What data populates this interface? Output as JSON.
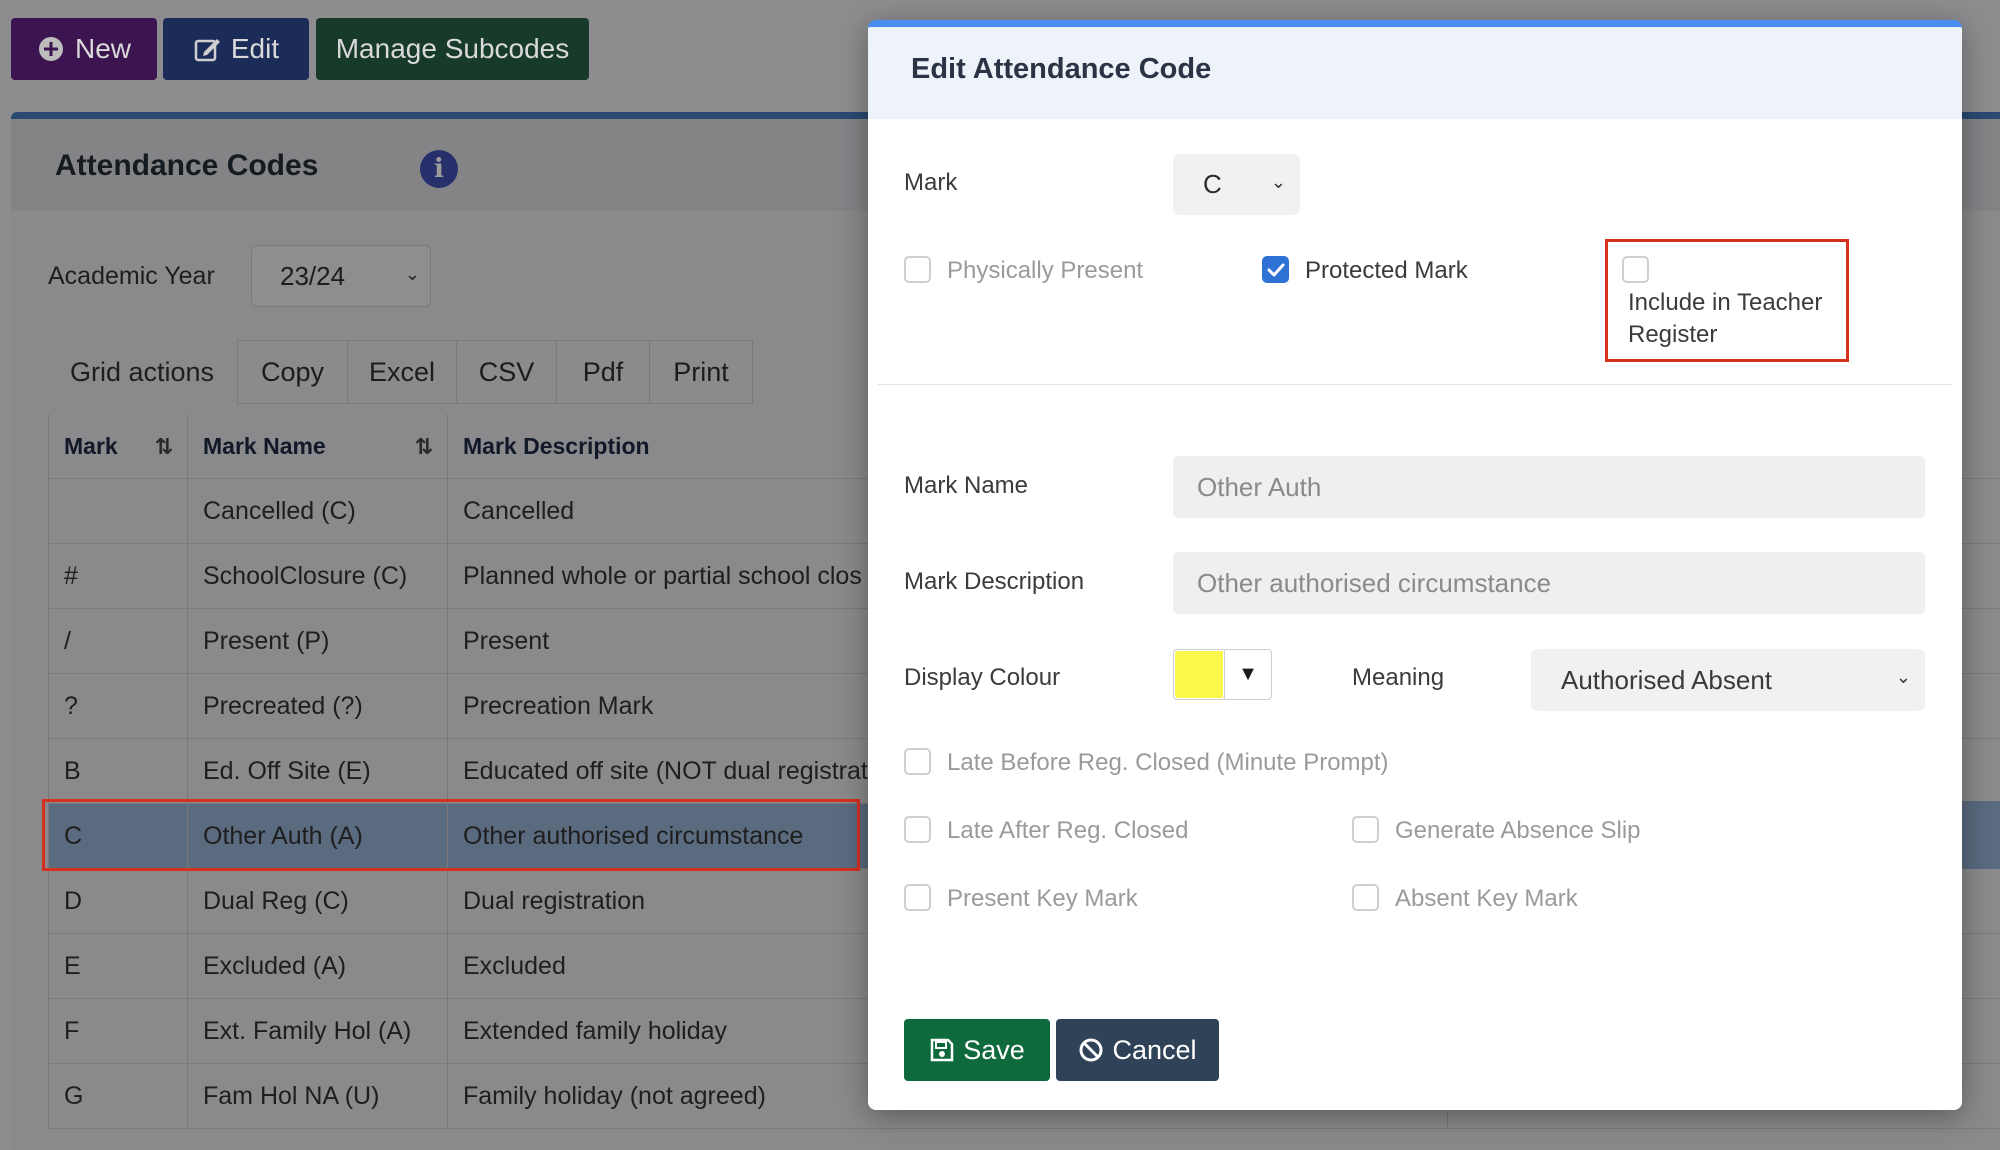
{
  "toolbar": {
    "new_label": "New",
    "edit_label": "Edit",
    "subcodes_label": "Manage Subcodes"
  },
  "panel": {
    "title": "Attendance Codes",
    "academic_year_label": "Academic Year",
    "academic_year_value": "23/24",
    "grid_actions_label": "Grid actions",
    "grid_buttons": [
      "Copy",
      "Excel",
      "CSV",
      "Pdf",
      "Print"
    ]
  },
  "table": {
    "headers": [
      "Mark",
      "Mark Name",
      "Mark Description"
    ],
    "rows": [
      {
        "mark": "",
        "name": "Cancelled (C)",
        "desc": "Cancelled"
      },
      {
        "mark": "#",
        "name": "SchoolClosure (C)",
        "desc": "Planned whole or partial school clos"
      },
      {
        "mark": "/",
        "name": "Present (P)",
        "desc": "Present"
      },
      {
        "mark": "?",
        "name": "Precreated (?)",
        "desc": "Precreation Mark"
      },
      {
        "mark": "B",
        "name": "Ed. Off Site (E)",
        "desc": "Educated off site (NOT dual registrat"
      },
      {
        "mark": "C",
        "name": "Other Auth (A)",
        "desc": "Other authorised circumstance"
      },
      {
        "mark": "D",
        "name": "Dual Reg (C)",
        "desc": "Dual registration"
      },
      {
        "mark": "E",
        "name": "Excluded (A)",
        "desc": "Excluded"
      },
      {
        "mark": "F",
        "name": "Ext. Family Hol (A)",
        "desc": "Extended family holiday"
      },
      {
        "mark": "G",
        "name": "Fam Hol NA (U)",
        "desc": "Family holiday (not agreed)"
      }
    ]
  },
  "modal": {
    "title": "Edit Attendance Code",
    "mark_label": "Mark",
    "mark_value": "C",
    "physically_present_label": "Physically Present",
    "protected_mark_label": "Protected Mark",
    "include_teacher_register_label_1": "Include in Teacher",
    "include_teacher_register_label_2": "Register",
    "mark_name_label": "Mark Name",
    "mark_name_value": "Other Auth",
    "mark_description_label": "Mark Description",
    "mark_description_value": "Other authorised circumstance",
    "display_colour_label": "Display Colour",
    "display_colour_value": "#fbf84b",
    "meaning_label": "Meaning",
    "meaning_value": "Authorised Absent",
    "late_before_label": "Late Before Reg. Closed (Minute Prompt)",
    "late_after_label": "Late After Reg. Closed",
    "generate_absence_label": "Generate Absence Slip",
    "present_key_label": "Present Key Mark",
    "absent_key_label": "Absent Key Mark",
    "save_label": "Save",
    "cancel_label": "Cancel"
  }
}
